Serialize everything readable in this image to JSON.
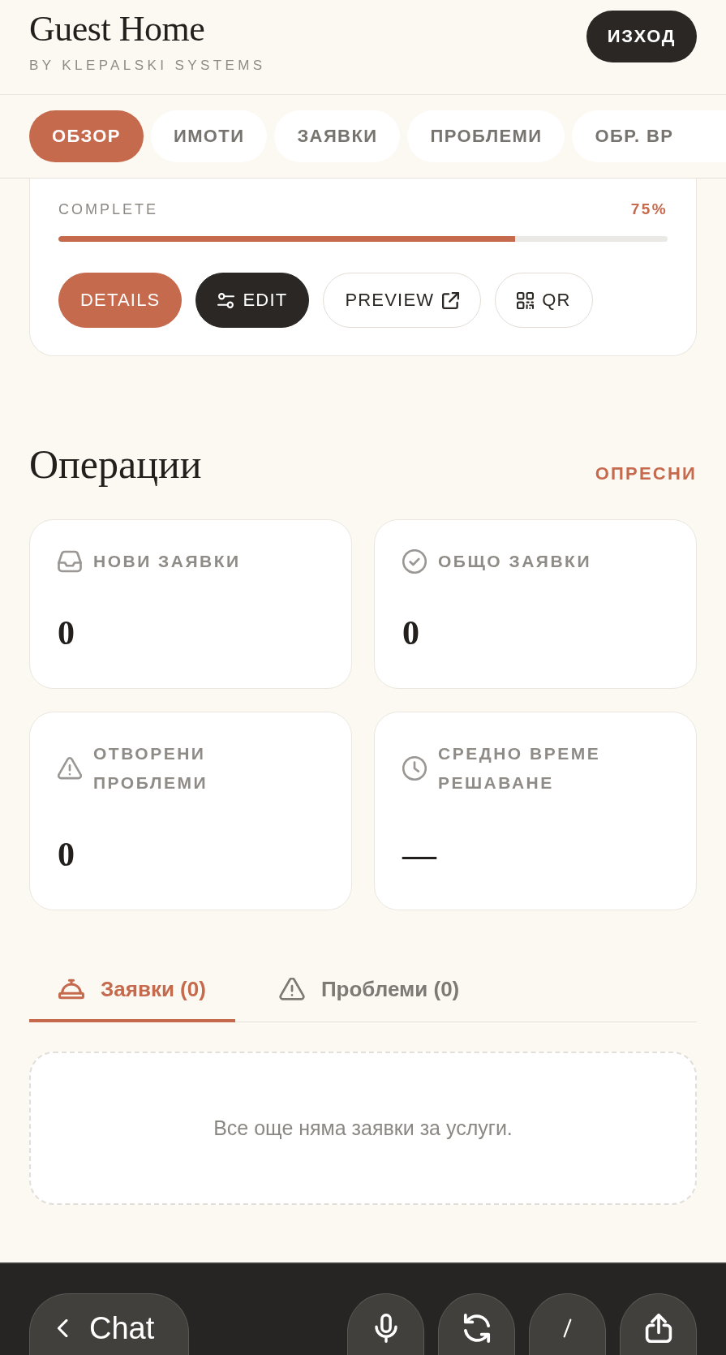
{
  "header": {
    "title": "Guest Home",
    "subtitle": "BY KLEPALSKI SYSTEMS",
    "logout_button": "ИЗХОД"
  },
  "nav_tabs": [
    {
      "label": "ОБЗОР",
      "selected": true
    },
    {
      "label": "ИМОТИ",
      "selected": false
    },
    {
      "label": "ЗАЯВКИ",
      "selected": false
    },
    {
      "label": "ПРОБЛЕМИ",
      "selected": false
    },
    {
      "label": "ОБР. ВР",
      "selected": false
    }
  ],
  "listing_card": {
    "progress": {
      "label": "COMPLETE",
      "reading": "75%",
      "level": 0.75
    },
    "actions": [
      {
        "kind": "primary",
        "label": "DETAILS"
      },
      {
        "kind": "edit",
        "label": "EDIT"
      },
      {
        "kind": "preview",
        "label": "PREVIEW"
      },
      {
        "kind": "qr",
        "label": "QR"
      }
    ]
  },
  "operations": {
    "title": "Операции",
    "refresh_link": "ОПРЕСНИ",
    "stats": [
      {
        "kind": "new",
        "label": "НОВИ ЗАЯВКИ",
        "value": "0"
      },
      {
        "kind": "total",
        "label": "ОБЩО ЗАЯВКИ",
        "value": "0"
      },
      {
        "kind": "issues",
        "label": "ОТВОРЕНИ ПРОБЛЕМИ",
        "value": "0"
      },
      {
        "kind": "duration",
        "label": "СРЕДНО ВРЕМЕ РЕШАВАНЕ",
        "value": "—"
      }
    ]
  },
  "list_tabs": [
    {
      "kind": "requests",
      "label": "Заявки (0)",
      "selected": true
    },
    {
      "kind": "issues",
      "label": "Проблеми (0)",
      "selected": false
    }
  ],
  "empty_state": {
    "message": "Все още няма заявки за услуги."
  },
  "bottom_bar": {
    "back_button": "Chat"
  }
}
